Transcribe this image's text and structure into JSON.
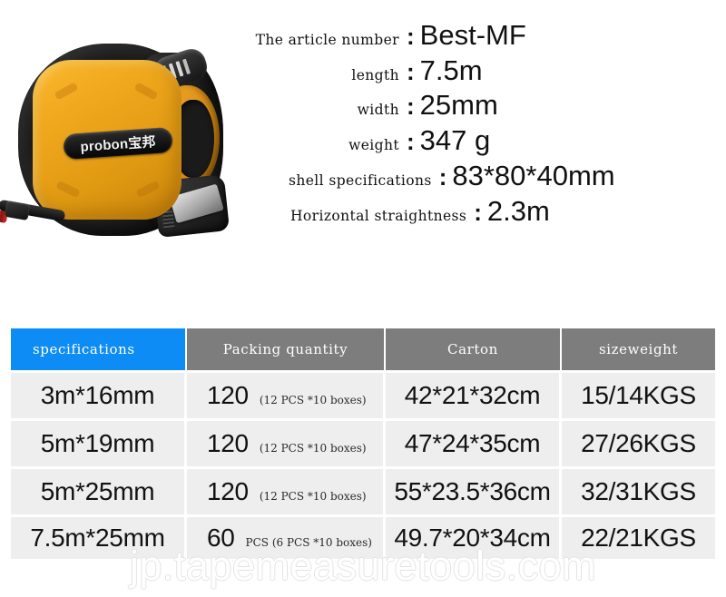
{
  "product": {
    "brand_badge": "probon宝邦",
    "image_alt": "yellow-black-tape-measure"
  },
  "specs": [
    {
      "label": "The article number",
      "colon": ":",
      "value": "Best-MF"
    },
    {
      "label": "length",
      "colon": ":",
      "value": "7.5m"
    },
    {
      "label": "width",
      "colon": ":",
      "value": "25mm"
    },
    {
      "label": "weight",
      "colon": ":",
      "value": "347 g"
    },
    {
      "label": "shell specifications",
      "colon": ":",
      "value": "83*80*40mm"
    },
    {
      "label": "Horizontal straightness",
      "colon": ":",
      "value": "2.3m"
    }
  ],
  "table": {
    "headers": [
      "specifications",
      "Packing quantity",
      "Carton",
      "sizeweight"
    ],
    "header_accent_color": "#0d8cf5",
    "header_color": "#7d7d7d",
    "rows": [
      {
        "specification": "3m*16mm",
        "packing_quantity": "120",
        "packing_note": "(12 PCS *10 boxes)",
        "carton": "42*21*32cm",
        "sizeweight": "15/14KGS"
      },
      {
        "specification": "5m*19mm",
        "packing_quantity": "120",
        "packing_note": "(12 PCS *10 boxes)",
        "carton": "47*24*35cm",
        "sizeweight": "27/26KGS"
      },
      {
        "specification": "5m*25mm",
        "packing_quantity": "120",
        "packing_note": "(12 PCS *10 boxes)",
        "carton": "55*23.5*36cm",
        "sizeweight": "32/31KGS"
      },
      {
        "specification": "7.5m*25mm",
        "packing_quantity": "60",
        "packing_note": "PCS (6 PCS *10 boxes)",
        "carton": "49.7*20*34cm",
        "sizeweight": "22/21KGS"
      }
    ]
  },
  "watermark": "jp.tapemeasuretools.com"
}
